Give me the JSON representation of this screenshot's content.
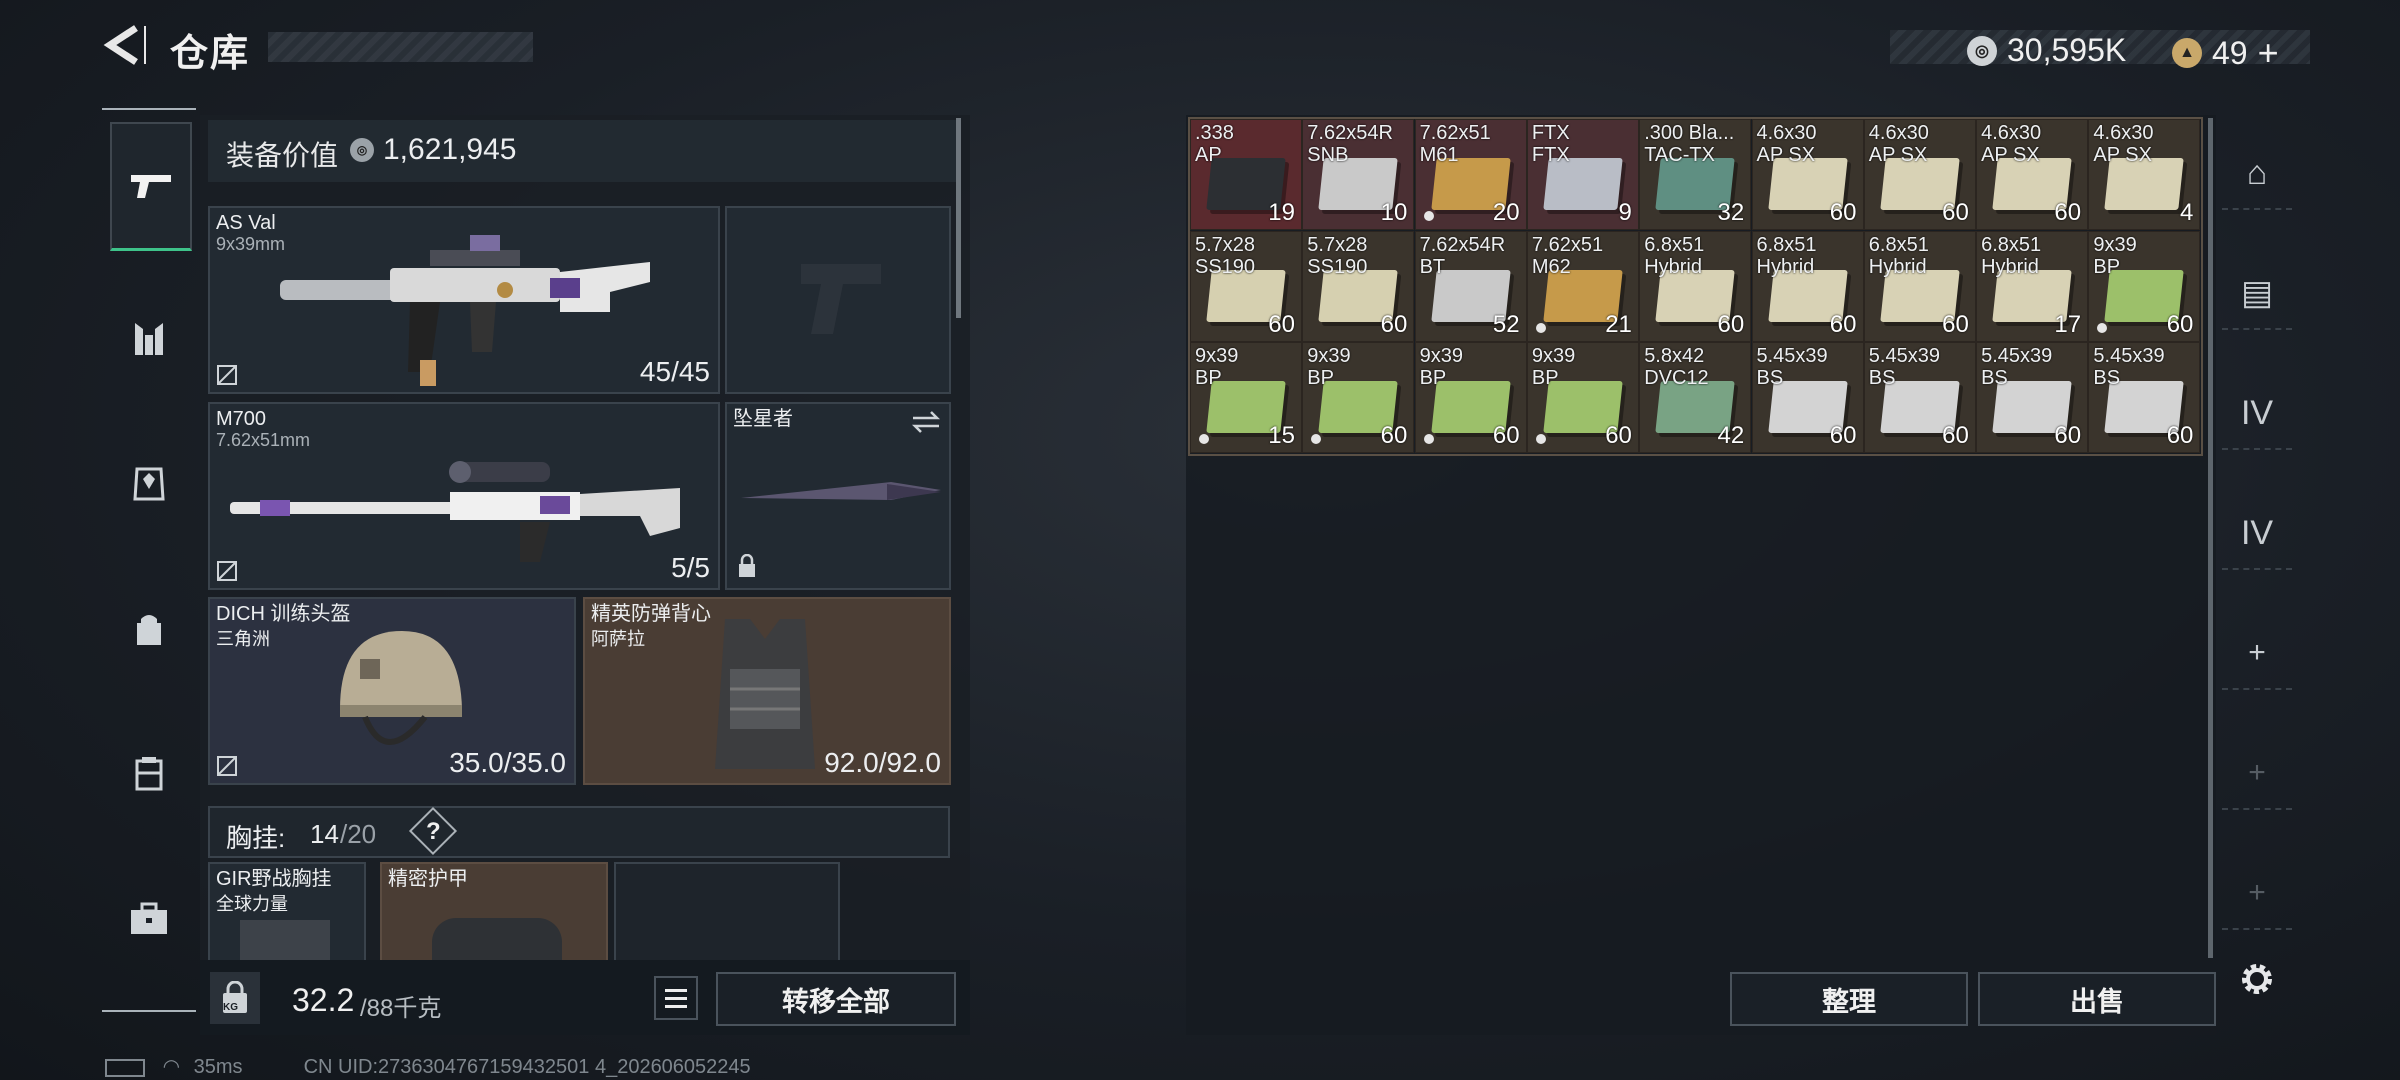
{
  "header": {
    "title": "仓库"
  },
  "currency": [
    {
      "icon": "silver-coin-icon",
      "value": "30,595K"
    },
    {
      "icon": "gold-coin-icon",
      "value": "49"
    }
  ],
  "left_rail": [
    {
      "name": "weapons-tab",
      "icon": "pistol-icon",
      "active": true
    },
    {
      "name": "chest-rig-tab",
      "icon": "vest-icon"
    },
    {
      "name": "armor-tab",
      "icon": "armor-icon"
    },
    {
      "name": "backpack-tab",
      "icon": "backpack-icon"
    },
    {
      "name": "rig-tab",
      "icon": "rig-icon"
    },
    {
      "name": "case-tab",
      "icon": "briefcase-icon"
    }
  ],
  "equipment": {
    "value_label": "装备价值",
    "value": "1,621,945",
    "primary": {
      "name": "AS Val",
      "caliber": "9x39mm",
      "ammo": "45/45"
    },
    "secondary": {
      "name": "M700",
      "caliber": "7.62x51mm",
      "ammo": "5/5"
    },
    "melee": {
      "name": "坠星者"
    },
    "helmet": {
      "name": "DICH 训练头盔",
      "sub": "三角洲",
      "durability": "35.0/35.0"
    },
    "armor": {
      "name": "精英防弹背心",
      "sub": "阿萨拉",
      "durability": "92.0/92.0"
    },
    "chest": {
      "label": "胸挂:",
      "current": "14",
      "max": "/20",
      "help": "?"
    },
    "rig": {
      "name": "GIR野战胸挂",
      "sub": "全球力量"
    },
    "bag": {
      "name": "精密护甲"
    }
  },
  "footer": {
    "weight": "32.2",
    "weight_max": "/88千克",
    "lock_tag": "KG",
    "transfer_all": "转移全部"
  },
  "inventory": [
    {
      "name": ".338\nAP",
      "count": "19",
      "color": "#2c2f33"
    },
    {
      "name": "7.62x54R\nSNB",
      "count": "10",
      "color": "#c9c9c9"
    },
    {
      "name": "7.62x51\nM61",
      "count": "20",
      "color": "#c69a4a",
      "dot": true
    },
    {
      "name": "FTX\nFTX",
      "count": "9",
      "color": "#b9bdc6"
    },
    {
      "name": ".300 Bla...\nTAC-TX",
      "count": "32",
      "color": "#5f8f82"
    },
    {
      "name": "4.6x30\nAP SX",
      "count": "60",
      "color": "#d8d2b5"
    },
    {
      "name": "4.6x30\nAP SX",
      "count": "60",
      "color": "#d8d2b5"
    },
    {
      "name": "4.6x30\nAP SX",
      "count": "60",
      "color": "#d8d2b5"
    },
    {
      "name": "4.6x30\nAP SX",
      "count": "4",
      "color": "#d8d2b5"
    },
    {
      "name": "5.7x28\nSS190",
      "count": "60",
      "color": "#d6d0b0"
    },
    {
      "name": "5.7x28\nSS190",
      "count": "60",
      "color": "#d6d0b0"
    },
    {
      "name": "7.62x54R\nBT",
      "count": "52",
      "color": "#c9c9c9"
    },
    {
      "name": "7.62x51\nM62",
      "count": "21",
      "color": "#c69a4a",
      "dot": true
    },
    {
      "name": "6.8x51\nHybrid",
      "count": "60",
      "color": "#d8d2b5"
    },
    {
      "name": "6.8x51\nHybrid",
      "count": "60",
      "color": "#d8d2b5"
    },
    {
      "name": "6.8x51\nHybrid",
      "count": "60",
      "color": "#d8d2b5"
    },
    {
      "name": "6.8x51\nHybrid",
      "count": "17",
      "color": "#d8d2b5"
    },
    {
      "name": "9x39\nBP",
      "count": "60",
      "color": "#9cc06a",
      "dot": true
    },
    {
      "name": "9x39\nBP",
      "count": "15",
      "color": "#9cc06a",
      "dot": true
    },
    {
      "name": "9x39\nBP",
      "count": "60",
      "color": "#9cc06a",
      "dot": true
    },
    {
      "name": "9x39\nBP",
      "count": "60",
      "color": "#9cc06a",
      "dot": true
    },
    {
      "name": "9x39\nBP",
      "count": "60",
      "color": "#9cc06a",
      "dot": true
    },
    {
      "name": "5.8x42\nDVC12",
      "count": "42",
      "color": "#79a384"
    },
    {
      "name": "5.45x39\nBS",
      "count": "60",
      "color": "#d3d3d3"
    },
    {
      "name": "5.45x39\nBS",
      "count": "60",
      "color": "#d3d3d3"
    },
    {
      "name": "5.45x39\nBS",
      "count": "60",
      "color": "#d3d3d3"
    },
    {
      "name": "5.45x39\nBS",
      "count": "60",
      "color": "#d3d3d3"
    }
  ],
  "actions": {
    "sort": "整理",
    "sell": "出售"
  },
  "right_rail": [
    {
      "name": "safe-box-tab",
      "icon": "safe-icon",
      "glyph": "⌂"
    },
    {
      "name": "storage-tab",
      "icon": "crate-icon",
      "glyph": "▤"
    },
    {
      "name": "storage-iv-a-tab",
      "icon": "crate-iv-icon",
      "glyph": "IV"
    },
    {
      "name": "storage-iv-b-tab",
      "icon": "crate-iv-icon",
      "glyph": "IV"
    },
    {
      "name": "add-storage-tab",
      "icon": "plus-icon",
      "glyph": "+"
    },
    {
      "name": "add-storage-tab-2",
      "icon": "plus-icon",
      "glyph": "+"
    },
    {
      "name": "add-storage-tab-3",
      "icon": "plus-icon",
      "glyph": "+"
    }
  ],
  "status": {
    "ping": "35ms",
    "uid": "CN UID:2736304767159432501 4_202606052245"
  }
}
